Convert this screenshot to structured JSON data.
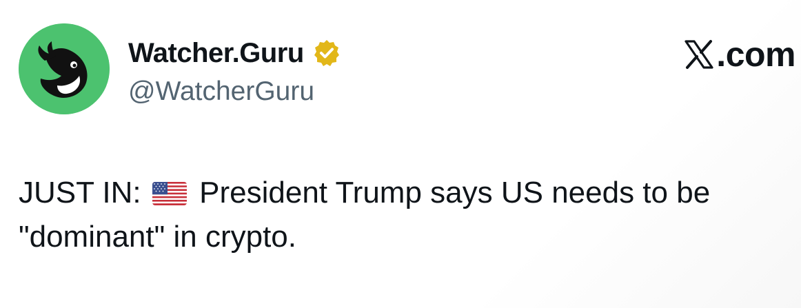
{
  "author": {
    "display_name": "Watcher.Guru",
    "handle": "@WatcherGuru",
    "verified": true,
    "avatar_icon": "whale-icon",
    "avatar_color": "#4cc26f"
  },
  "brand": {
    "icon": "x-logo-icon",
    "label": ".com"
  },
  "tweet": {
    "prefix": "JUST IN:",
    "emoji": "us-flag-icon",
    "body": "President Trump says US needs to be \"dominant\" in crypto."
  },
  "colors": {
    "text": "#0f1419",
    "secondary_text": "#536471",
    "verified_badge": "#e2b719"
  }
}
